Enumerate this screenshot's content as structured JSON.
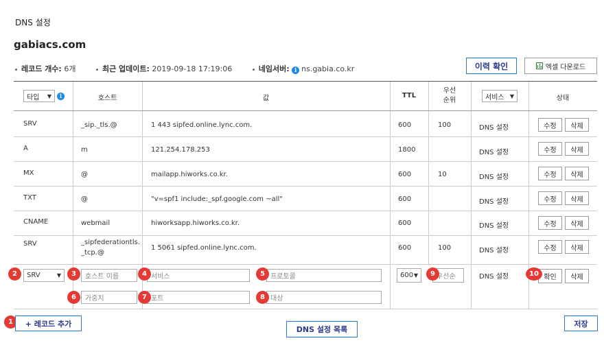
{
  "header": {
    "page_title": "DNS 설정",
    "domain": "gabiacs.com"
  },
  "meta": {
    "record_count_label": "레코드 개수:",
    "record_count_value": "6개",
    "updated_label": "최근 업데이트:",
    "updated_value": "2019-09-18 17:19:06",
    "ns_label": "네임서버:",
    "ns_value": "ns.gabia.co.kr"
  },
  "toolbar": {
    "history_label": "이력 확인",
    "excel_label": "엑셀 다운로드"
  },
  "table": {
    "type_filter": "타입",
    "host_header": "호스트",
    "value_header": "값",
    "ttl_header": "TTL",
    "priority_header_1": "우선",
    "priority_header_2": "순위",
    "service_filter": "서비스",
    "status_header": "상태",
    "edit_label": "수정",
    "delete_label": "삭제",
    "rows": [
      {
        "type": "SRV",
        "host": "_sip._tls.@",
        "host2": "",
        "value": "1 443 sipfed.online.lync.com.",
        "ttl": "600",
        "priority": "100",
        "service": "DNS 설정"
      },
      {
        "type": "A",
        "host": "m",
        "host2": "",
        "value": "121.254.178.253",
        "ttl": "1800",
        "priority": "",
        "service": "DNS 설정"
      },
      {
        "type": "MX",
        "host": "@",
        "host2": "",
        "value": "mailapp.hiworks.co.kr.",
        "ttl": "600",
        "priority": "10",
        "service": "DNS 설정"
      },
      {
        "type": "TXT",
        "host": "@",
        "host2": "",
        "value": "\"v=spf1 include:_spf.google.com ~all\"",
        "ttl": "600",
        "priority": "",
        "service": "DNS 설정"
      },
      {
        "type": "CNAME",
        "host": "webmail",
        "host2": "",
        "value": "hiworksapp.hiworks.co.kr.",
        "ttl": "600",
        "priority": "",
        "service": "DNS 설정"
      },
      {
        "type": "SRV",
        "host": "_sipfederationtls.",
        "host2": "_tcp.@",
        "value": "1 5061 sipfed.online.lync.com.",
        "ttl": "600",
        "priority": "100",
        "service": "DNS 설정"
      }
    ]
  },
  "new_record": {
    "type_value": "SRV",
    "host_placeholder": "호스트 이름",
    "service_placeholder": "서비스",
    "protocol_placeholder": "프로토콜",
    "weight_placeholder": "가중치",
    "port_placeholder": "포트",
    "target_placeholder": "대상",
    "ttl_value": "600",
    "priority_placeholder": "우선순",
    "service": "DNS 설정",
    "confirm_label": "확인",
    "delete_label": "삭제"
  },
  "badges": [
    "1",
    "2",
    "3",
    "4",
    "5",
    "6",
    "7",
    "8",
    "9",
    "10"
  ],
  "footer": {
    "add_record_label": "+ 레코드 추가",
    "list_label": "DNS 설정 목록",
    "save_label": "저장"
  },
  "colors": {
    "accent": "#2b7bd5",
    "badge": "#e53935",
    "info": "#1e88e5",
    "excel": "#2e7d32"
  }
}
